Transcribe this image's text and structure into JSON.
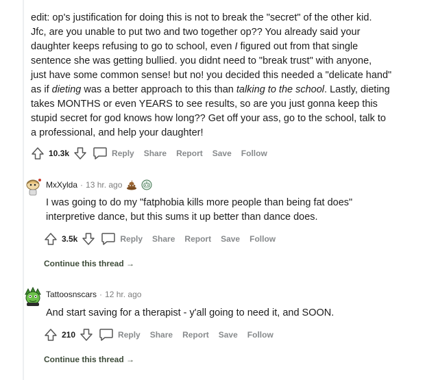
{
  "top_comment": {
    "body_lines": [
      "edit: op's justification for doing this is not to break the \"secret\" of the other kid.",
      "Jfc, are you unable to put two and two together op?? You already said your",
      "daughter keeps refusing to go to school, even ",
      "I",
      " figured out from that single",
      "sentence she was getting bullied. you didnt need to \"break trust\" with anyone,",
      "just have some common sense! but no! you decided this needed a \"delicate hand\"",
      "as if ",
      "dieting",
      " was a better approach to this than ",
      "talking to the school",
      ". Lastly, dieting",
      "takes MONTHS or even YEARS to see results, so are you just gonna keep this",
      "stupid secret for god knows how long?? Get off your ass, go to the school, talk to",
      "a professional, and help your daughter!"
    ],
    "votes": "10.3k",
    "actions": {
      "reply": "Reply",
      "share": "Share",
      "report": "Report",
      "save": "Save",
      "follow": "Follow"
    }
  },
  "comments": [
    {
      "username": "MxXylda",
      "separator": "·",
      "time": "13 hr. ago",
      "body_lines": [
        "I was going to do my \"fatphobia kills more people than being fat does\"",
        "interpretive dance, but this sums it up better than dance does."
      ],
      "votes": "3.5k",
      "actions": {
        "reply": "Reply",
        "share": "Share",
        "report": "Report",
        "save": "Save",
        "follow": "Follow"
      },
      "continue": "Continue this thread →",
      "awards": [
        "poop-award-icon",
        "robot-award-icon"
      ]
    },
    {
      "username": "Tattoosnscars",
      "separator": "·",
      "time": "12 hr. ago",
      "body_lines": [
        "And start saving for a therapist - y'all going to need it, and SOON."
      ],
      "votes": "210",
      "actions": {
        "reply": "Reply",
        "share": "Share",
        "report": "Report",
        "save": "Save",
        "follow": "Follow"
      },
      "continue": "Continue this thread →"
    }
  ],
  "colors": {
    "meta": "#878a8c",
    "continue": "#3d4b39",
    "thread_line": "#edeff1"
  }
}
